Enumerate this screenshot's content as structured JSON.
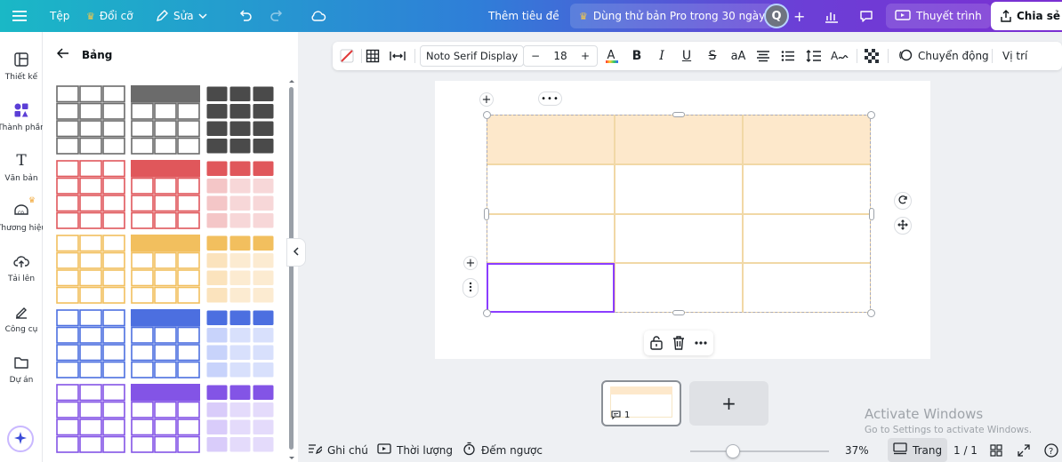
{
  "topbar": {
    "file_label": "Tệp",
    "resize_label": "Đổi cỡ",
    "edit_label": "Sửa",
    "title_placeholder": "Thêm tiêu đề",
    "pro_trial_label": "Dùng thử bản Pro trong 30 ngày",
    "avatar_initial": "Q",
    "present_label": "Thuyết trình",
    "share_label": "Chia sẻ"
  },
  "rail": {
    "items": [
      {
        "label": "Thiết kế",
        "icon": "layout-icon"
      },
      {
        "label": "Thành phần",
        "icon": "elements-icon"
      },
      {
        "label": "Văn bản",
        "icon": "text-icon"
      },
      {
        "label": "Thương hiệu",
        "icon": "brand-icon"
      },
      {
        "label": "Tải lên",
        "icon": "upload-cloud-icon"
      },
      {
        "label": "Công cụ",
        "icon": "tools-icon"
      },
      {
        "label": "Dự án",
        "icon": "folder-icon"
      }
    ]
  },
  "panel": {
    "title": "Bảng",
    "table_styles": [
      {
        "style": "grid",
        "color": "#6b6b6b"
      },
      {
        "style": "header",
        "color": "#6b6b6b"
      },
      {
        "style": "filled",
        "color": "#4a4a4a",
        "light": "#4a4a4a"
      },
      {
        "style": "grid",
        "color": "#e0575b"
      },
      {
        "style": "header",
        "color": "#e0575b"
      },
      {
        "style": "filled",
        "color": "#e0575b",
        "light": "#f4c6c7"
      },
      {
        "style": "grid",
        "color": "#f2bf5e"
      },
      {
        "style": "header",
        "color": "#f2bf5e"
      },
      {
        "style": "filled",
        "color": "#f2bf5e",
        "light": "#fbe3bd"
      },
      {
        "style": "grid",
        "color": "#4c6fe0"
      },
      {
        "style": "header",
        "color": "#4c6fe0"
      },
      {
        "style": "filled",
        "color": "#4c6fe0",
        "light": "#c8d3fb"
      },
      {
        "style": "grid",
        "color": "#8354e6"
      },
      {
        "style": "header",
        "color": "#8354e6"
      },
      {
        "style": "filled",
        "color": "#8354e6",
        "light": "#d9ccfa"
      }
    ]
  },
  "toolbar": {
    "font_family": "Noto Serif Display",
    "font_size": "18",
    "case_label": "aA",
    "animate_label": "Chuyển động",
    "position_label": "Vị trí"
  },
  "canvas": {
    "table_rows": 4,
    "table_cols": 3,
    "header_fill": "#fde8cb",
    "border_color": "#f1d8a6",
    "selection_color": "#8b3dff"
  },
  "pages": {
    "page_comment_count": "1"
  },
  "bottombar": {
    "notes_label": "Ghi chú",
    "duration_label": "Thời lượng",
    "timer_label": "Đếm ngược",
    "zoom_percent": 37,
    "zoom_label": "37%",
    "view_label": "Trang",
    "page_counter": "1 / 1"
  },
  "watermark": {
    "line1": "Activate Windows",
    "line2": "Go to Settings to activate Windows."
  }
}
